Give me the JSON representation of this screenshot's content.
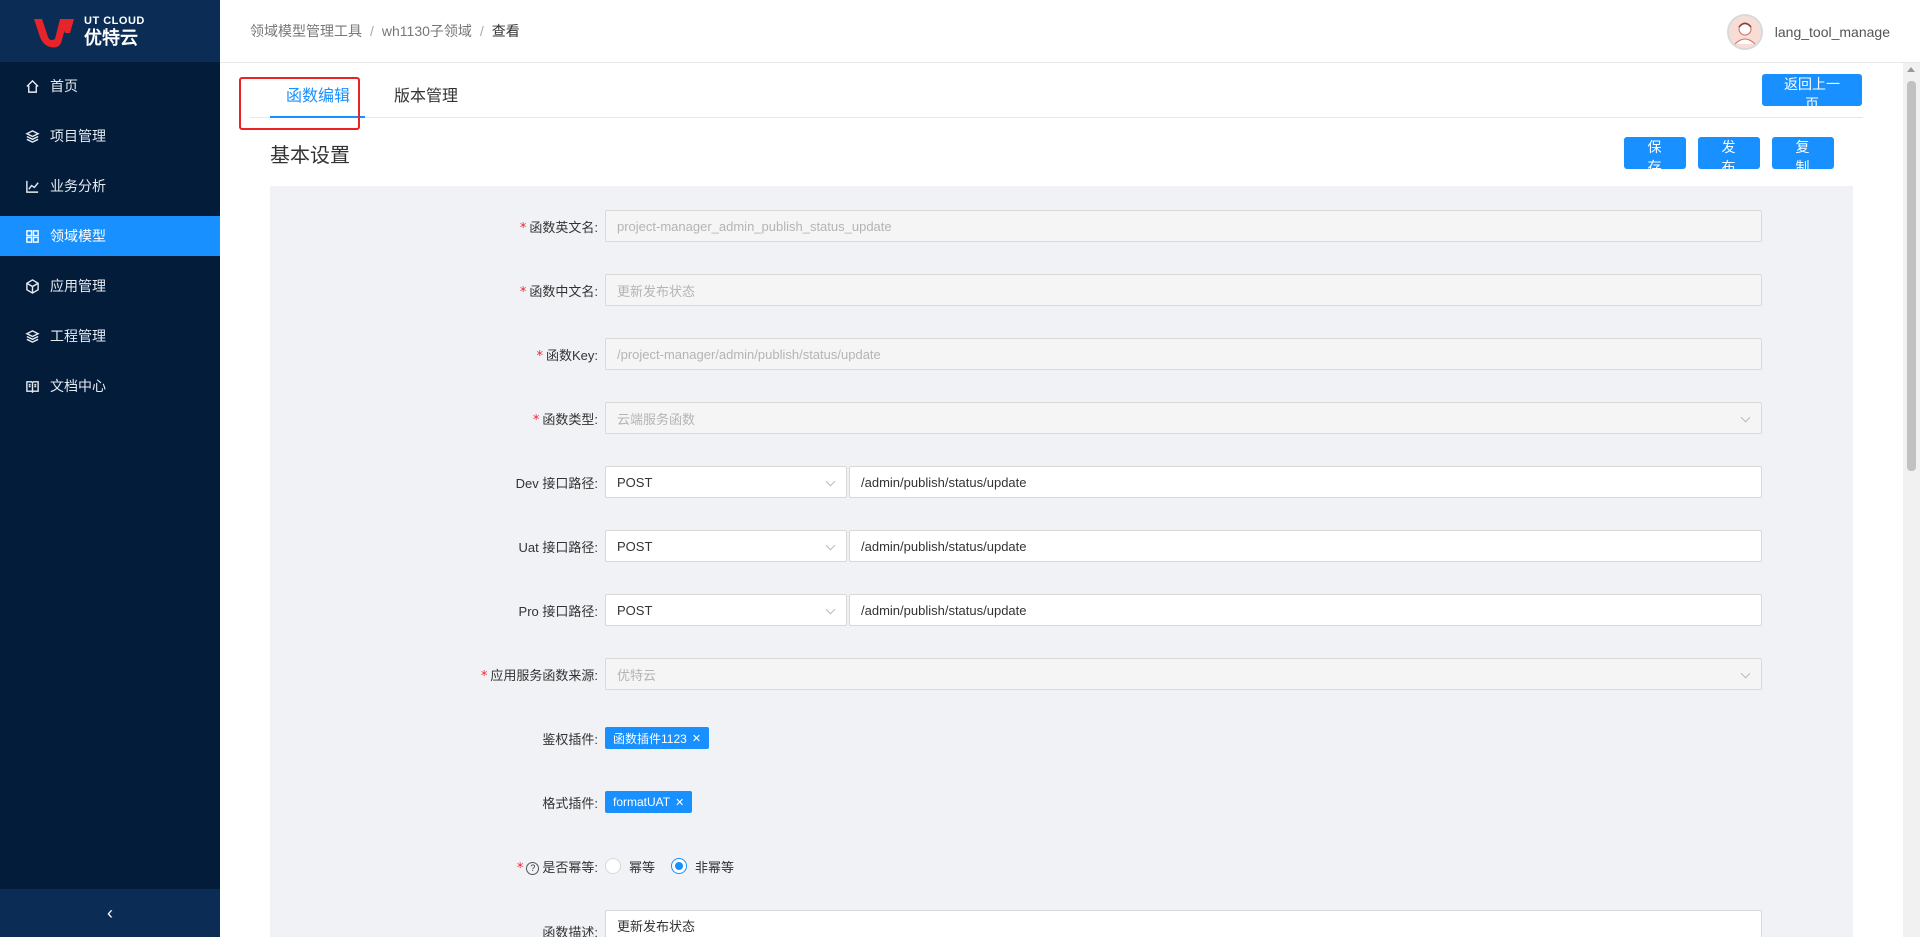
{
  "logo": {
    "en": "UT CLOUD",
    "cn": "优特云"
  },
  "sidebar": {
    "items": [
      {
        "label": "首页",
        "icon": "home-icon"
      },
      {
        "label": "项目管理",
        "icon": "layers-icon"
      },
      {
        "label": "业务分析",
        "icon": "chart-icon"
      },
      {
        "label": "领域模型",
        "icon": "grid-icon",
        "active": true
      },
      {
        "label": "应用管理",
        "icon": "cube-icon"
      },
      {
        "label": "工程管理",
        "icon": "layers-icon"
      },
      {
        "label": "文档中心",
        "icon": "book-icon"
      }
    ],
    "collapse": "‹"
  },
  "header": {
    "breadcrumb": [
      "领域模型管理工具",
      "wh1130子领域",
      "查看"
    ],
    "separator": "/",
    "username": "lang_tool_manage"
  },
  "tabs": [
    {
      "label": "函数编辑",
      "active": true
    },
    {
      "label": "版本管理"
    }
  ],
  "actions": {
    "back": "返回上一页",
    "save": "保 存",
    "publish": "发 布",
    "copy": "复 制"
  },
  "section": {
    "title": "基本设置"
  },
  "form": {
    "en_name": {
      "label": "函数英文名:",
      "value": "project-manager_admin_publish_status_update"
    },
    "cn_name": {
      "label": "函数中文名:",
      "value": "更新发布状态"
    },
    "key": {
      "label": "函数Key:",
      "value": "/project-manager/admin/publish/status/update"
    },
    "type": {
      "label": "函数类型:",
      "value": "云端服务函数"
    },
    "dev": {
      "label": "Dev 接口路径:",
      "method": "POST",
      "path": "/admin/publish/status/update"
    },
    "uat": {
      "label": "Uat 接口路径:",
      "method": "POST",
      "path": "/admin/publish/status/update"
    },
    "pro": {
      "label": "Pro 接口路径:",
      "method": "POST",
      "path": "/admin/publish/status/update"
    },
    "source": {
      "label": "应用服务函数来源:",
      "value": "优特云"
    },
    "auth_plugin": {
      "label": "鉴权插件:",
      "tag": "函数插件1123"
    },
    "format_plugin": {
      "label": "格式插件:",
      "tag": "formatUAT"
    },
    "idempotent": {
      "label": "是否幂等:",
      "help": "?",
      "options": [
        "幂等",
        "非幂等"
      ],
      "selected": "非幂等"
    },
    "desc": {
      "label": "函数描述:",
      "value": "更新发布状态"
    }
  },
  "colors": {
    "primary": "#1890ff",
    "sidebar": "#031c3a",
    "required": "#f5222d",
    "highlight": "#e8242b"
  }
}
